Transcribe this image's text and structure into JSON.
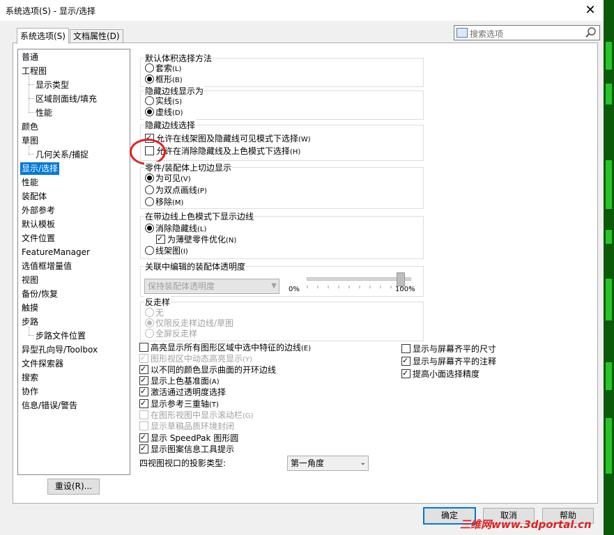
{
  "window": {
    "title": "系统选项(S) - 显示/选择",
    "close_glyph": "✕"
  },
  "tabs": [
    {
      "label": "系统选项(S)",
      "active": true
    },
    {
      "label": "文档属性(D)",
      "active": false
    }
  ],
  "search": {
    "placeholder": "搜索选项",
    "icon": "search-icon"
  },
  "tree": {
    "items": [
      {
        "label": "普通"
      },
      {
        "label": "工程图"
      },
      {
        "label": "显示类型",
        "child": true
      },
      {
        "label": "区域剖面线/填充",
        "child": true
      },
      {
        "label": "性能",
        "child": true
      },
      {
        "label": "颜色"
      },
      {
        "label": "草图"
      },
      {
        "label": "几何关系/捕捉",
        "child": true
      },
      {
        "label": "显示/选择",
        "selected": true
      },
      {
        "label": "性能"
      },
      {
        "label": "装配体"
      },
      {
        "label": "外部参考"
      },
      {
        "label": "默认模板"
      },
      {
        "label": "文件位置"
      },
      {
        "label": "FeatureManager"
      },
      {
        "label": "选值框增量值"
      },
      {
        "label": "视图"
      },
      {
        "label": "备份/恢复"
      },
      {
        "label": "触摸"
      },
      {
        "label": "步路"
      },
      {
        "label": "步路文件位置",
        "child": true
      },
      {
        "label": "异型孔向导/Toolbox"
      },
      {
        "label": "文件探索器"
      },
      {
        "label": "搜索"
      },
      {
        "label": "协作"
      },
      {
        "label": "信息/错误/警告"
      }
    ],
    "reset_label": "重设(R)..."
  },
  "groups": {
    "body_select": {
      "title": "默认体积选择方法",
      "options": [
        {
          "label": "套索",
          "key": "(L)",
          "on": false
        },
        {
          "label": "框形",
          "key": "(B)",
          "on": true
        }
      ]
    },
    "hidden_display": {
      "title": "隐藏边线显示为",
      "options": [
        {
          "label": "实线",
          "key": "(S)",
          "on": false
        },
        {
          "label": "虚线",
          "key": "(D)",
          "on": true
        }
      ]
    },
    "hidden_select": {
      "title": "隐藏边线选择",
      "options": [
        {
          "label": "允许在线架图及隐藏线可见模式下选择",
          "key": "(W)",
          "on": true
        },
        {
          "label": "允许在消除隐藏线及上色模式下选择",
          "key": "(H)",
          "on": false
        }
      ]
    },
    "tangent": {
      "title": "零件/装配体上切边显示",
      "options": [
        {
          "label": "为可见",
          "key": "(V)",
          "on": true
        },
        {
          "label": "为双点画线",
          "key": "(P)",
          "on": false
        },
        {
          "label": "移除",
          "key": "(M)",
          "on": false
        }
      ]
    },
    "shaded_edges": {
      "title": "在带边线上色模式下显示边线",
      "options": [
        {
          "label": "消除隐藏线",
          "key": "(L)",
          "on": true
        },
        {
          "label": "为薄壁零件优化",
          "key": "(N)",
          "on": true
        },
        {
          "label": "线架图",
          "key": "(I)",
          "on": false
        }
      ]
    },
    "transparency": {
      "title": "关联中编辑的装配体透明度",
      "combo_value": "保持装配体透明度",
      "min_label": "0%",
      "max_label": "100%",
      "level": 0.9
    },
    "antialias": {
      "title": "反走样",
      "options": [
        {
          "label": "无",
          "key": "",
          "on": false
        },
        {
          "label": "仅限反走样边线/草图",
          "key": "",
          "on": true
        },
        {
          "label": "全屏反走样",
          "key": "",
          "on": false
        }
      ]
    }
  },
  "checks_left": [
    {
      "label": "高亮显示所有图形区域中选中特征的边线",
      "key": "(E)",
      "on": false,
      "disabled": false
    },
    {
      "label": "图形视区中动态高亮显示",
      "key": "(Y)",
      "on": true,
      "disabled": true
    },
    {
      "label": "以不同的颜色显示曲面的开环边线",
      "key": "",
      "on": true,
      "disabled": false
    },
    {
      "label": "显示上色基准面",
      "key": "(A)",
      "on": true,
      "disabled": false
    },
    {
      "label": "激活通过透明度选择",
      "key": "",
      "on": true,
      "disabled": false
    },
    {
      "label": "显示参考三重轴",
      "key": "(T)",
      "on": true,
      "disabled": false
    },
    {
      "label": "在图形视图中显示滚动栏",
      "key": "(G)",
      "on": false,
      "disabled": true
    },
    {
      "label": "显示草稿品质环境封闭",
      "key": "",
      "on": false,
      "disabled": true
    },
    {
      "label": "显示 SpeedPak 图形圆",
      "key": "",
      "on": true,
      "disabled": false
    },
    {
      "label": "显示图案信息工具提示",
      "key": "",
      "on": true,
      "disabled": false
    }
  ],
  "checks_right": [
    {
      "label": "显示与屏幕齐平的尺寸",
      "on": false
    },
    {
      "label": "显示与屏幕齐平的注释",
      "on": true
    },
    {
      "label": "提高小面选择精度",
      "on": true
    }
  ],
  "projection": {
    "label": "四视图视口的投影类型:",
    "value": "第一角度"
  },
  "buttons": {
    "ok": "确定",
    "cancel": "取消",
    "help": "帮助"
  },
  "watermark": "三维网www.3dportal.cn"
}
